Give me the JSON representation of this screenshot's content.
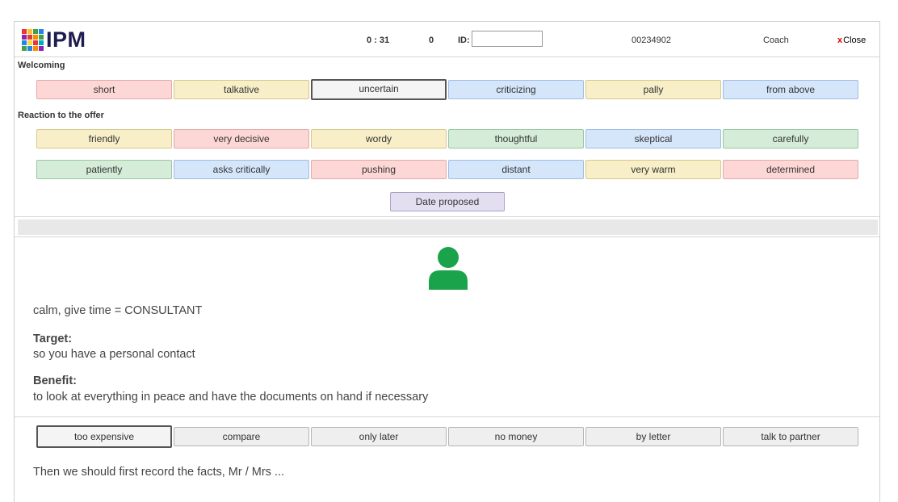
{
  "header": {
    "logo_text": "IPM",
    "timer": "0 : 31",
    "counter": "0",
    "id_label": "ID:",
    "id_value": "",
    "number": "00234902",
    "coach": "Coach",
    "close_x": "x",
    "close_label": "Close"
  },
  "welcoming": {
    "label": "Welcoming",
    "buttons": [
      "short",
      "talkative",
      "uncertain",
      "criticizing",
      "pally",
      "from above"
    ]
  },
  "reaction": {
    "label": "Reaction to the offer",
    "row1": [
      "friendly",
      "very decisive",
      "wordy",
      "thoughtful",
      "skeptical",
      "carefully"
    ],
    "row2": [
      "patiently",
      "asks critically",
      "pushing",
      "distant",
      "very warm",
      "determined"
    ],
    "date_button": "Date proposed"
  },
  "content": {
    "headline": "calm, give time = CONSULTANT",
    "target_label": "Target:",
    "target_text": "so you have a personal contact",
    "benefit_label": "Benefit:",
    "benefit_text": "to look at everything in peace and have the documents on hand if necessary"
  },
  "objections": {
    "buttons": [
      "too expensive",
      "compare",
      "only later",
      "no money",
      "by letter",
      "talk to partner"
    ],
    "response": "Then we should first record the facts, Mr / Mrs ..."
  },
  "colors": {
    "pink": "#fdd7d5",
    "yellow": "#f8efc8",
    "blue": "#d5e6fb",
    "green": "#d5ecd8",
    "gray": "#efefef",
    "lavender": "#e3dff0",
    "avatar_green": "#1aa34a",
    "close_red": "#dd0000"
  },
  "icons": {
    "avatar": "person-icon",
    "close": "close-icon"
  }
}
